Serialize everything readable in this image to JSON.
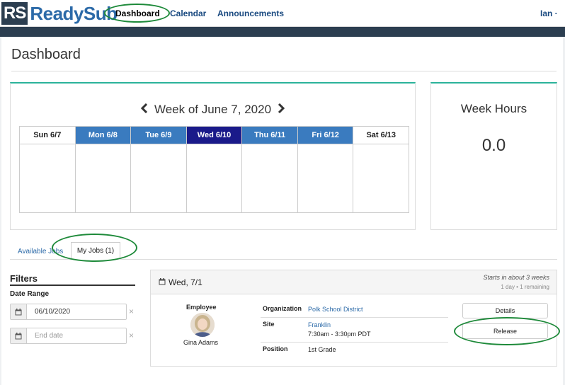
{
  "app": {
    "logo_mark": "RS",
    "logo_text": "ReadySub"
  },
  "nav": {
    "items": [
      {
        "label": "Dashboard",
        "active": true
      },
      {
        "label": "Calendar"
      },
      {
        "label": "Announcements"
      }
    ],
    "user": "Ian ·"
  },
  "page": {
    "title": "Dashboard"
  },
  "week": {
    "heading": "Week of June 7, 2020",
    "days": [
      {
        "label": "Sun 6/7"
      },
      {
        "label": "Mon 6/8"
      },
      {
        "label": "Tue 6/9"
      },
      {
        "label": "Wed 6/10"
      },
      {
        "label": "Thu 6/11"
      },
      {
        "label": "Fri 6/12"
      },
      {
        "label": "Sat 6/13"
      }
    ]
  },
  "hours": {
    "title": "Week Hours",
    "value": "0.0"
  },
  "tabs": [
    {
      "label": "Available Jobs"
    },
    {
      "label": "My Jobs (1)",
      "active": true
    }
  ],
  "filters": {
    "title": "Filters",
    "date_range_label": "Date Range",
    "start_value": "06/10/2020",
    "end_placeholder": "End date",
    "clear_glyph": "×"
  },
  "job": {
    "date": "Wed, 7/1",
    "starts": "Starts in about 3 weeks",
    "meta": "1 day  •  1 remaining",
    "employee_label": "Employee",
    "employee_name": "Gina Adams",
    "organization_label": "Organization",
    "organization": "Polk School District",
    "site_label": "Site",
    "site": "Franklin",
    "time": "7:30am - 3:30pm PDT",
    "position_label": "Position",
    "position": "1st Grade",
    "details_button": "Details",
    "release_button": "Release"
  },
  "colors": {
    "header_dark": "#2c3e50",
    "accent_teal": "#2bb39a",
    "day_blue": "#3a7bbf",
    "day_today": "#1a1a8a",
    "link_blue": "#2c6aa8",
    "annotation_green": "#1e8a3a"
  },
  "icons": {
    "prev": "chevron-left-icon",
    "next": "chevron-right-icon",
    "calendar": "calendar-icon",
    "clear": "clear-icon"
  }
}
